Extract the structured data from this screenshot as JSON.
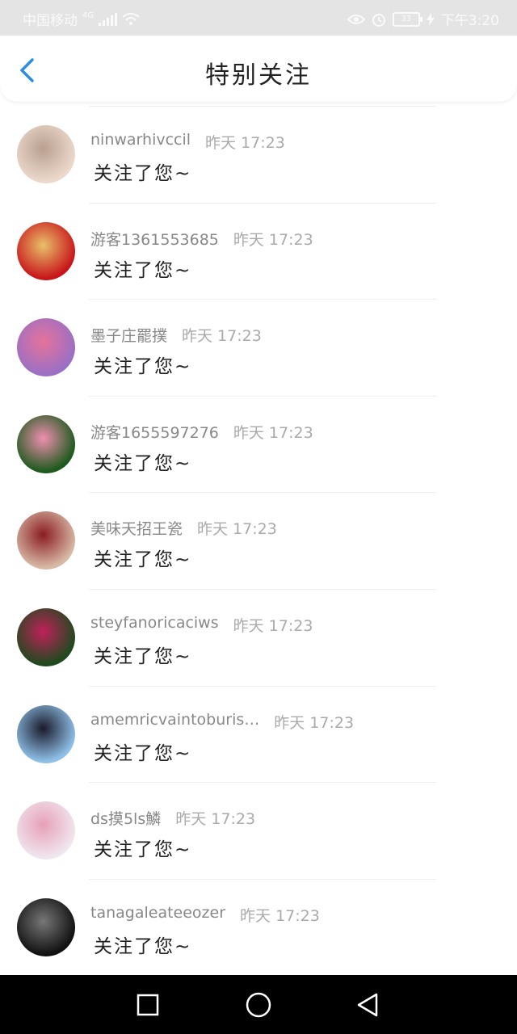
{
  "status_bar": {
    "carrier": "中国移动",
    "network": "4G",
    "battery": "33",
    "time": "下午3:20"
  },
  "header": {
    "title": "特别关注",
    "back_icon": "chevron-left-icon"
  },
  "items": [
    {
      "name": "ninwarhivccil",
      "time": "昨天 17:23",
      "message": "关注了您~",
      "avatar_colors": [
        "#ecd9cc",
        "#b9a08f"
      ]
    },
    {
      "name": "游客1361553685",
      "time": "昨天 17:23",
      "message": "关注了您~",
      "avatar_colors": [
        "#c8151a",
        "#e8c06a"
      ]
    },
    {
      "name": "墨子庄罷撲",
      "time": "昨天 17:23",
      "message": "关注了您~",
      "avatar_colors": [
        "#9a6fc5",
        "#e6739a"
      ]
    },
    {
      "name": "游客1655597276",
      "time": "昨天 17:23",
      "message": "关注了您~",
      "avatar_colors": [
        "#1d5a1d",
        "#f08fb0"
      ]
    },
    {
      "name": "美味天招王瓷",
      "time": "昨天 17:23",
      "message": "关注了您~",
      "avatar_colors": [
        "#d8b9a5",
        "#8a1c22"
      ]
    },
    {
      "name": "steyfanoricaciws",
      "time": "昨天 17:23",
      "message": "关注了您~",
      "avatar_colors": [
        "#1f4a1e",
        "#c0205a"
      ]
    },
    {
      "name": "amemricvaintoburis…",
      "time": "昨天 17:23",
      "message": "关注了您~",
      "avatar_colors": [
        "#8fc0e8",
        "#1a1a2a"
      ]
    },
    {
      "name": "ds摸5ls鱗",
      "time": "昨天 17:23",
      "message": "关注了您~",
      "avatar_colors": [
        "#f0e6ee",
        "#e7a0b8"
      ]
    },
    {
      "name": "tanagaleateeozer",
      "time": "昨天 17:23",
      "message": "关注了您~",
      "avatar_colors": [
        "#111111",
        "#777777"
      ]
    }
  ],
  "nav_bar": {
    "recents_icon": "square-icon",
    "home_icon": "circle-icon",
    "back_icon": "triangle-back-icon"
  }
}
